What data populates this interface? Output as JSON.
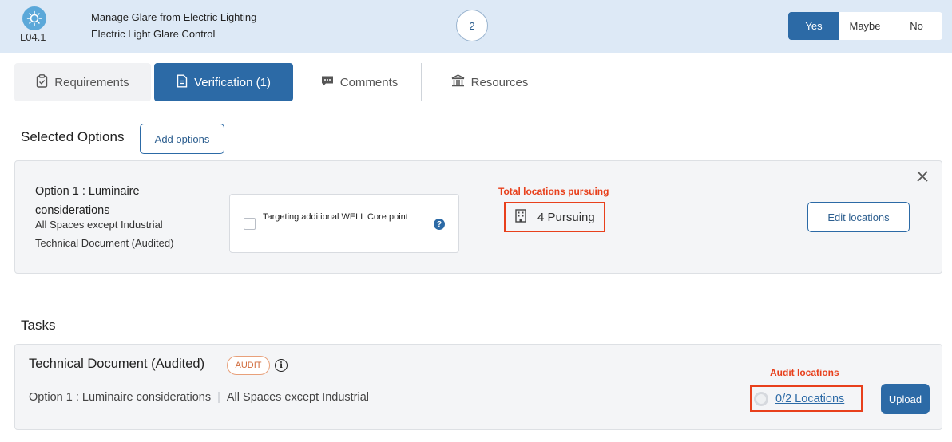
{
  "header": {
    "feature_code": "L04.1",
    "feature_title": "Manage Glare from Electric Lighting",
    "feature_subtitle": "Electric Light Glare Control",
    "points": "2",
    "response_options": {
      "yes": "Yes",
      "maybe": "Maybe",
      "no": "No"
    },
    "selected_response": "Yes"
  },
  "tabs": [
    {
      "label": "Requirements",
      "icon": "clipboard-check-icon"
    },
    {
      "label": "Verification (1)",
      "icon": "document-icon",
      "active": true
    },
    {
      "label": "Comments",
      "icon": "comment-icon"
    },
    {
      "label": "Resources",
      "icon": "bank-icon"
    }
  ],
  "selected_options": {
    "title": "Selected Options",
    "add_button": "Add options",
    "option": {
      "name": "Option 1 :  Luminaire considerations",
      "spaces": "All Spaces except Industrial",
      "document": "Technical Document (Audited)",
      "core_point_label": "Targeting additional WELL Core point",
      "annotation": "Total locations pursuing",
      "pursuing": "4 Pursuing",
      "edit_button": "Edit locations"
    }
  },
  "tasks": {
    "title": "Tasks",
    "task": {
      "title": "Technical Document (Audited)",
      "badge": "AUDIT",
      "option": "Option 1 :  Luminaire considerations",
      "spaces": "All Spaces except Industrial",
      "annotation": "Audit locations",
      "locations_link": "0/2 Locations",
      "upload_button": "Upload"
    }
  },
  "colors": {
    "primary": "#2c6aa6",
    "header_bg": "#dde9f6",
    "annotation_red": "#e8401c"
  }
}
